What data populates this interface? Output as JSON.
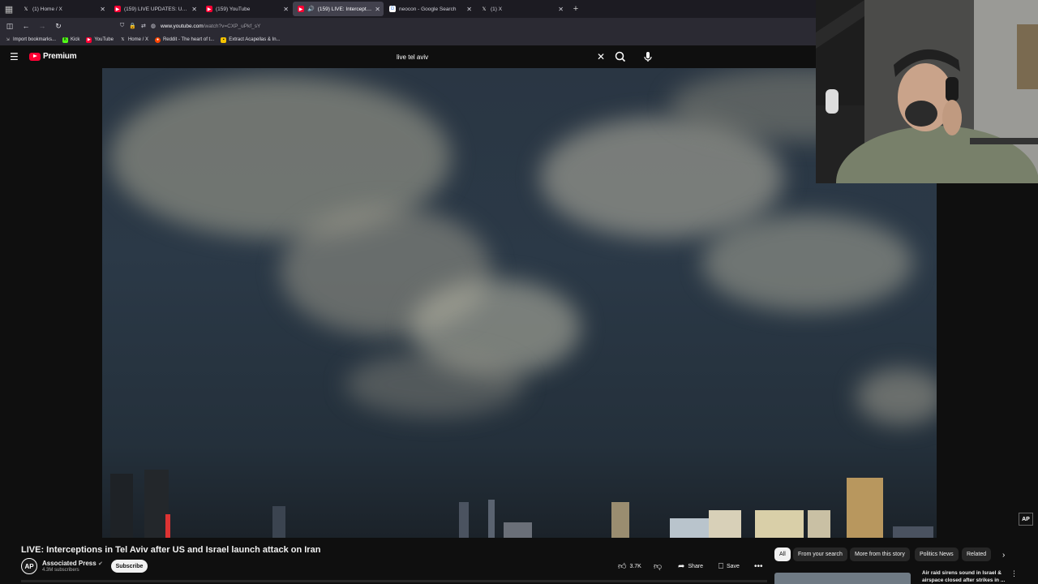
{
  "browser": {
    "tabs": [
      {
        "label": "(1) Home / X",
        "icon": "x-logo-icon",
        "active": false
      },
      {
        "label": "(159) LIVE UPDATES: US attacks",
        "icon": "youtube-icon",
        "active": false
      },
      {
        "label": "(159) YouTube",
        "icon": "youtube-icon",
        "active": false
      },
      {
        "label": "(159) LIVE: Interceptions in",
        "icon": "youtube-icon",
        "active": true
      },
      {
        "label": "neocon - Google Search",
        "icon": "google-icon",
        "active": false
      },
      {
        "label": "(1) X",
        "icon": "x-logo-icon",
        "active": false
      }
    ],
    "url_host": "www.youtube.com",
    "url_path": "/watch?v=CXP_uPkf_sY",
    "bookmarks": [
      {
        "label": "Import bookmarks...",
        "icon": "import-icon"
      },
      {
        "label": "Kick",
        "icon": "kick-icon"
      },
      {
        "label": "YouTube",
        "icon": "youtube-icon"
      },
      {
        "label": "Home / X",
        "icon": "x-logo-icon"
      },
      {
        "label": "Reddit - The heart of t...",
        "icon": "reddit-icon"
      },
      {
        "label": "Extract Acapellas & In...",
        "icon": "folder-icon"
      }
    ]
  },
  "youtube": {
    "brand": "Premium",
    "search_value": "live tel aviv"
  },
  "video": {
    "title": "LIVE: Interceptions in Tel Aviv after US and Israel launch attack on Iran",
    "channel_name": "Associated Press",
    "channel_avatar_text": "AP",
    "subscribers": "4.3M subscribers",
    "subscribe_label": "Subscribe",
    "likes": "3.7K",
    "share_label": "Share",
    "save_label": "Save",
    "watermark": "AP"
  },
  "chips": [
    "All",
    "From your search",
    "More from this story",
    "Politics News",
    "Related"
  ],
  "recommendation": {
    "title": "Air raid sirens sound in Israel & airspace closed after strikes in ..."
  },
  "colors": {
    "brand_red": "#ff0033",
    "page_bg": "#0f0f0f",
    "chip_bg": "#272727"
  }
}
